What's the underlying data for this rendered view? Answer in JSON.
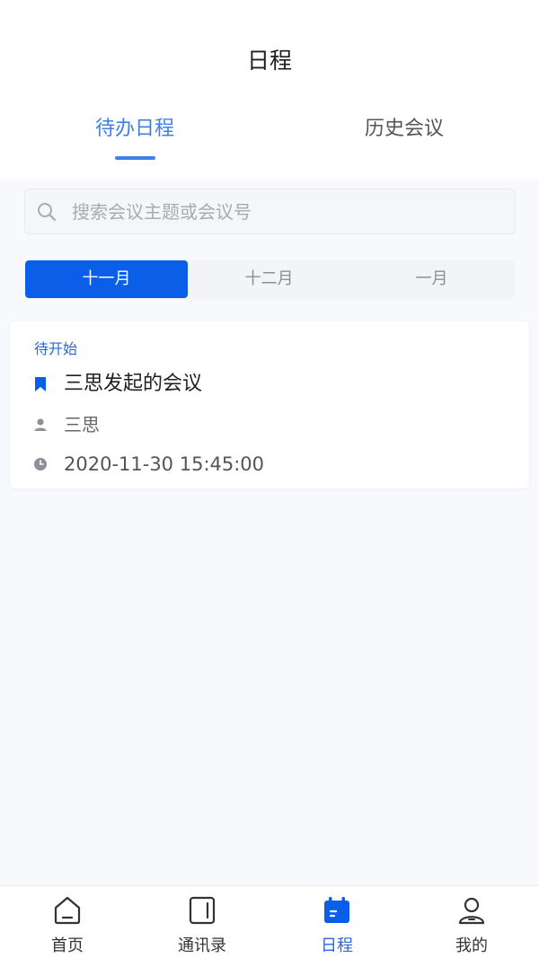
{
  "header": {
    "title": "日程",
    "tabs": [
      {
        "label": "待办日程",
        "active": true
      },
      {
        "label": "历史会议",
        "active": false
      }
    ]
  },
  "search": {
    "placeholder": "搜索会议主题或会议号",
    "icon": "search-icon"
  },
  "months": [
    {
      "label": "十一月",
      "active": true
    },
    {
      "label": "十二月",
      "active": false
    },
    {
      "label": "一月",
      "active": false
    }
  ],
  "meetings": [
    {
      "status": "待开始",
      "title": "三思发起的会议",
      "host": "三思",
      "time": "2020-11-30 15:45:00"
    }
  ],
  "bottom_nav": [
    {
      "label": "首页",
      "icon": "home-icon",
      "active": false
    },
    {
      "label": "通讯录",
      "icon": "contacts-icon",
      "active": false
    },
    {
      "label": "日程",
      "icon": "calendar-icon",
      "active": true
    },
    {
      "label": "我的",
      "icon": "profile-icon",
      "active": false
    }
  ],
  "colors": {
    "accent": "#3f7fe6",
    "segment_active": "#0a5ee8",
    "background": "#f8f9fc"
  }
}
